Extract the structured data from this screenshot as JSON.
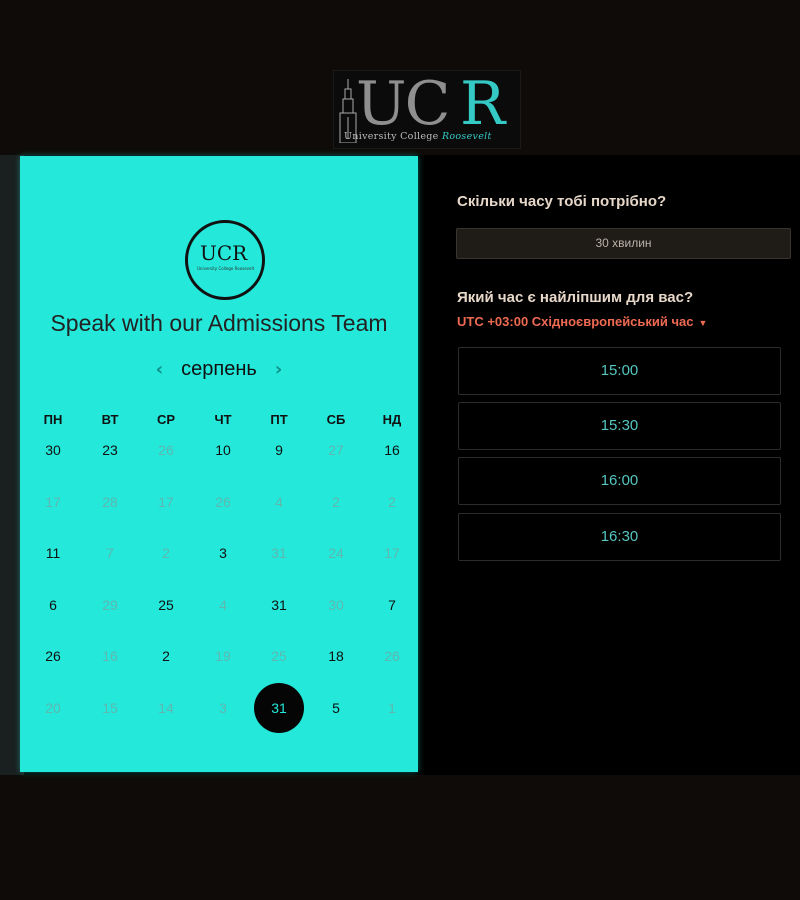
{
  "logo": {
    "letters_gray": "UC",
    "letter_accent": "R",
    "tagline_main": "University College",
    "tagline_accent": "Roosevelt",
    "badge_text": "UCR",
    "badge_sub": "University College Roosevelt"
  },
  "panel": {
    "title": "Speak with our Admissions Team",
    "month": "серпень",
    "prev_icon": "chevron-left-icon",
    "next_icon": "chevron-right-icon",
    "weekdays": [
      "ПН",
      "ВТ",
      "СР",
      "ЧТ",
      "ПТ",
      "СБ",
      "НД"
    ],
    "weeks": [
      [
        {
          "d": "30",
          "a": true
        },
        {
          "d": "23",
          "a": true
        },
        {
          "d": "26",
          "a": false
        },
        {
          "d": "10",
          "a": true
        },
        {
          "d": "9",
          "a": true
        },
        {
          "d": "27",
          "a": false
        },
        {
          "d": "16",
          "a": true
        }
      ],
      [
        {
          "d": "17",
          "a": false
        },
        {
          "d": "28",
          "a": false
        },
        {
          "d": "17",
          "a": false
        },
        {
          "d": "26",
          "a": false
        },
        {
          "d": "4",
          "a": false
        },
        {
          "d": "2",
          "a": false
        },
        {
          "d": "2",
          "a": false
        }
      ],
      [
        {
          "d": "11",
          "a": true
        },
        {
          "d": "7",
          "a": false
        },
        {
          "d": "2",
          "a": false
        },
        {
          "d": "3",
          "a": true
        },
        {
          "d": "31",
          "a": false
        },
        {
          "d": "24",
          "a": false
        },
        {
          "d": "17",
          "a": false
        }
      ],
      [
        {
          "d": "6",
          "a": true
        },
        {
          "d": "29",
          "a": false
        },
        {
          "d": "25",
          "a": true
        },
        {
          "d": "4",
          "a": false
        },
        {
          "d": "31",
          "a": true
        },
        {
          "d": "30",
          "a": false
        },
        {
          "d": "7",
          "a": true
        }
      ],
      [
        {
          "d": "26",
          "a": true
        },
        {
          "d": "16",
          "a": false
        },
        {
          "d": "2",
          "a": true
        },
        {
          "d": "19",
          "a": false
        },
        {
          "d": "25",
          "a": false
        },
        {
          "d": "18",
          "a": true
        },
        {
          "d": "26",
          "a": false
        }
      ],
      [
        {
          "d": "20",
          "a": false
        },
        {
          "d": "15",
          "a": false
        },
        {
          "d": "14",
          "a": false
        },
        {
          "d": "3",
          "a": false
        },
        {
          "d": "31",
          "a": true,
          "selected": true
        },
        {
          "d": "5",
          "a": true
        },
        {
          "d": "1",
          "a": false
        }
      ]
    ]
  },
  "right": {
    "duration_question": "Скільки часу тобі потрібно?",
    "duration_value": "30 хвилин",
    "time_question": "Який час є найліпшим для вас?",
    "timezone": "UTC +03:00 Східноєвропейський час",
    "timezone_icon": "caret-down-icon",
    "slots": [
      "15:00",
      "15:30",
      "16:00",
      "16:30"
    ]
  },
  "colors": {
    "panel": "#23e8da",
    "accent_text": "#55c6c0",
    "timezone": "#ef6a52"
  }
}
